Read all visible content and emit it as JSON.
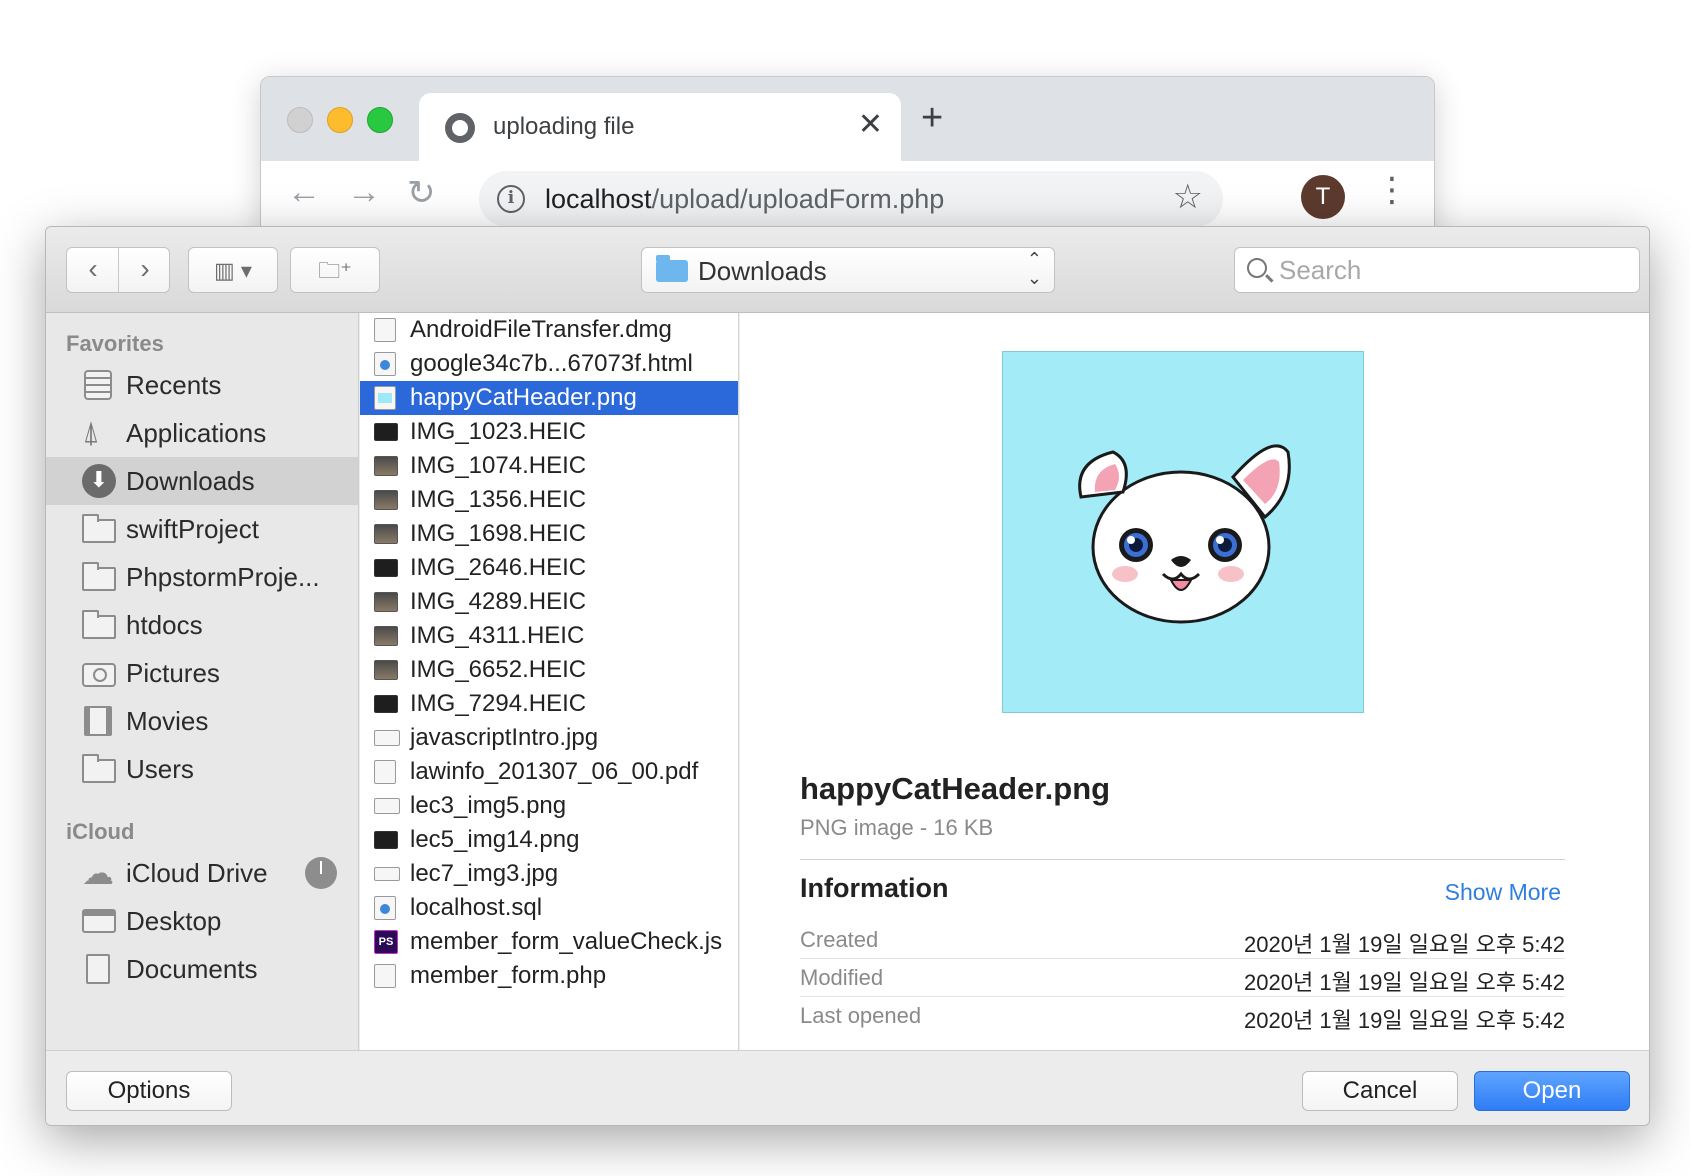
{
  "browser": {
    "tab_title": "uploading file",
    "url_host": "localhost",
    "url_path": "/upload/uploadForm.php",
    "avatar_initial": "T"
  },
  "dialog": {
    "location": "Downloads",
    "search_placeholder": "Search",
    "sidebar": {
      "favorites_title": "Favorites",
      "favorites": [
        {
          "label": "Recents",
          "icon": "recents-icon"
        },
        {
          "label": "Applications",
          "icon": "applications-icon"
        },
        {
          "label": "Downloads",
          "icon": "downloads-icon",
          "selected": true
        },
        {
          "label": "swiftProject",
          "icon": "folder-icon"
        },
        {
          "label": "PhpstormProje...",
          "icon": "folder-icon"
        },
        {
          "label": "htdocs",
          "icon": "folder-icon"
        },
        {
          "label": "Pictures",
          "icon": "camera-icon"
        },
        {
          "label": "Movies",
          "icon": "film-icon"
        },
        {
          "label": "Users",
          "icon": "folder-icon"
        }
      ],
      "icloud_title": "iCloud",
      "icloud": [
        {
          "label": "iCloud Drive",
          "icon": "cloud-icon"
        },
        {
          "label": "Desktop",
          "icon": "desktop-icon"
        },
        {
          "label": "Documents",
          "icon": "documents-icon"
        }
      ]
    },
    "files": [
      "AndroidFileTransfer.dmg",
      "google34c7b...67073f.html",
      "happyCatHeader.png",
      "IMG_1023.HEIC",
      "IMG_1074.HEIC",
      "IMG_1356.HEIC",
      "IMG_1698.HEIC",
      "IMG_2646.HEIC",
      "IMG_4289.HEIC",
      "IMG_4311.HEIC",
      "IMG_6652.HEIC",
      "IMG_7294.HEIC",
      "javascriptIntro.jpg",
      "lawinfo_201307_06_00.pdf",
      "lec3_img5.png",
      "lec5_img14.png",
      "lec7_img3.jpg",
      "localhost.sql",
      "member_form_valueCheck.js",
      "member_form.php"
    ],
    "selected_file": "happyCatHeader.png",
    "preview": {
      "name": "happyCatHeader.png",
      "kind": "PNG image - 16 KB",
      "info_title": "Information",
      "show_more": "Show More",
      "meta": [
        {
          "label": "Created",
          "value": "2020년 1월 19일 일요일 오후 5:42"
        },
        {
          "label": "Modified",
          "value": "2020년 1월 19일 일요일 오후 5:42"
        },
        {
          "label": "Last opened",
          "value": "2020년 1월 19일 일요일 오후 5:42"
        }
      ]
    },
    "buttons": {
      "options": "Options",
      "cancel": "Cancel",
      "open": "Open"
    }
  }
}
